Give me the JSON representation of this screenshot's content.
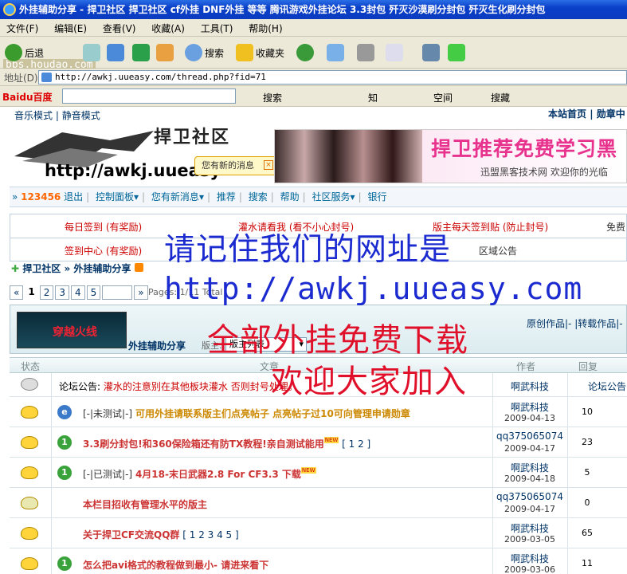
{
  "window": {
    "title": "外挂辅助分享 - 捍卫社区  捍卫社区 cf外挂 DNF外挂 等等 腾讯游戏外挂论坛 3.3封包 歼灭沙漠刷分封包 歼灭生化刷分封包"
  },
  "menu": [
    "文件(F)",
    "编辑(E)",
    "查看(V)",
    "收藏(A)",
    "工具(T)",
    "帮助(H)"
  ],
  "watermark": "bbs.houdao.com",
  "toolbar": {
    "back": "后退",
    "search": "搜索",
    "favorites": "收藏夹"
  },
  "address": {
    "label": "地址(D)",
    "url": "http://awkj.uueasy.com/thread.php?fid=71"
  },
  "baidu": {
    "logo": "Baidu百度",
    "search": "搜索",
    "space": "空间",
    "hide": "搜藏",
    "knowledge": "知"
  },
  "top_links": {
    "music": "音乐模式",
    "static": "静音模式",
    "home": "本站首页",
    "medal": "勋章中"
  },
  "logo": {
    "title": "捍卫社区",
    "url": "http://awkj.uueasy"
  },
  "tooltip": {
    "text": "您有新的消息"
  },
  "banner": {
    "title": "捍卫推荐免费学习黑",
    "sub": "迅盟黑客技术网 欢迎你的光临"
  },
  "nav": {
    "user": "123456",
    "logout": "退出",
    "panel": "控制面板",
    "msg": "您有新消息",
    "recommend": "推荐",
    "search": "搜索",
    "help": "帮助",
    "service": "社区服务",
    "bank": "银行"
  },
  "notice": {
    "c1": "每日签到 (有奖励)",
    "c2": "灌水请看我 (看不小心封号)",
    "c3": "版主每天签到贴 (防止封号)",
    "c4": "免费",
    "c5": "签到中心 (有奖励)",
    "c6": "区域公告"
  },
  "breadcrumb": {
    "home": "捍卫社区",
    "forum": "外挂辅助分享"
  },
  "pager": {
    "pages": [
      "1",
      "2",
      "3",
      "4",
      "5"
    ],
    "prev": "«",
    "next": "»",
    "info": "Pages: 1/11  Total"
  },
  "forum": {
    "img_text": "穿越火线",
    "name": "外挂辅助分享",
    "mod": "版主:",
    "sel": "版主列表",
    "tabs": "原创作品|-  |转载作品|-"
  },
  "thead": {
    "status": "状态",
    "title": "文章",
    "author": "作者",
    "reply": "回复",
    "last": "论坛公告"
  },
  "forum_notice": {
    "label": "论坛公告:",
    "text": "灌水的注意别在其他板块灌水 否则封号处理。",
    "author": "啊武科技",
    "last": "论坛公告"
  },
  "threads": [
    {
      "icon": "e",
      "pre": "[-|未测试|-]",
      "title": "可用外挂请联系版主们点亮帖子 点亮帖子过10可向管理申请勋章",
      "pages": "",
      "author": "啊武科技",
      "date": "2009-04-13",
      "reply": "10"
    },
    {
      "icon": "1",
      "pre": "",
      "title": "3.3刷分封包!和360保险箱还有防TX教程!亲自测试能用",
      "pages": "[ 1 2 ]",
      "author": "qq375065074",
      "date": "2009-04-17",
      "reply": "23"
    },
    {
      "icon": "1",
      "pre": "[-|已测试|-]",
      "title": "4月18-末日武器2.8 For CF3.3  下载",
      "pages": "",
      "author": "啊武科技",
      "date": "2009-04-18",
      "reply": "5"
    },
    {
      "icon": "1",
      "pre": "",
      "title": "本栏目招收有管理水平的版主",
      "pages": "",
      "author": "qq375065074",
      "date": "2009-04-17",
      "reply": "0"
    },
    {
      "icon": "1",
      "pre": "",
      "title": "关于捍卫CF交流QQ群",
      "pages": "[ 1 2 3 4 5 ]",
      "author": "啊武科技",
      "date": "2009-03-05",
      "reply": "65"
    },
    {
      "icon": "1",
      "pre": "",
      "title": "怎么把avi格式的教程做到最小- 请进来看下",
      "pages": "",
      "author": "啊武科技",
      "date": "2009-03-06",
      "reply": "11"
    }
  ],
  "overlay": {
    "l1": "请记住我们的网址是",
    "l2": "http://awkj.uueasy.com",
    "l3": "全部外挂免费下载",
    "l4": "欢迎大家加入"
  },
  "colors": {
    "title_bar": "#0a3fc8",
    "overlay_blue": "#1b2bd0",
    "overlay_red": "#e0102a",
    "thread_title": "#cc3333"
  }
}
